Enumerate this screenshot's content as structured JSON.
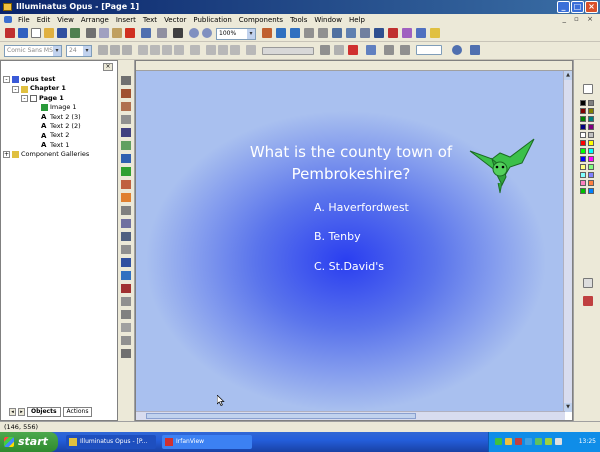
{
  "window": {
    "title": "Illuminatus Opus - [Page 1]"
  },
  "menu": [
    "File",
    "Edit",
    "View",
    "Arrange",
    "Insert",
    "Text",
    "Vector",
    "Publication",
    "Components",
    "Tools",
    "Window",
    "Help"
  ],
  "toolbar": {
    "zoom_value": "100%",
    "font_name": "Comic Sans MS",
    "font_size": "24"
  },
  "tree": {
    "items": [
      {
        "label": "opus test",
        "bold": true
      },
      {
        "label": "Chapter 1",
        "bold": true
      },
      {
        "label": "Page 1",
        "bold": true
      },
      {
        "label": "Image 1",
        "bold": false
      },
      {
        "label": "Text 2 (3)",
        "bold": false
      },
      {
        "label": "Text 2 (2)",
        "bold": false
      },
      {
        "label": "Text 2",
        "bold": false
      },
      {
        "label": "Text 1",
        "bold": false
      },
      {
        "label": "Component Galleries",
        "bold": false
      }
    ]
  },
  "left_tabs": {
    "objects": "Objects",
    "actions": "Actions"
  },
  "slide": {
    "question": "What is the county town of Pembrokeshire?",
    "answers": [
      "A. Haverfordwest",
      "B. Tenby",
      "C. St.David's"
    ]
  },
  "status": {
    "coords": "(146, 556)"
  },
  "taskbar": {
    "start": "start",
    "items": [
      "Illuminatus Opus - [P...",
      "IrfanView"
    ],
    "clock": "13:25"
  },
  "colors": {
    "title_bar": "#0a246a",
    "slide_center": "#2a3ef0",
    "slide_edge": "#a9c0ef",
    "taskbar": "#245edb",
    "start_button": "#3c9a3c"
  },
  "palette_colors": [
    "#000000",
    "#808080",
    "#800000",
    "#808000",
    "#008000",
    "#008080",
    "#000080",
    "#800080",
    "#ffffff",
    "#c0c0c0",
    "#ff0000",
    "#ffff00",
    "#00ff00",
    "#00ffff",
    "#0000ff",
    "#ff00ff",
    "#ffff80",
    "#80ff80",
    "#80ffff",
    "#8080ff",
    "#ff80c0",
    "#ff8040",
    "#00c000",
    "#0080ff"
  ]
}
